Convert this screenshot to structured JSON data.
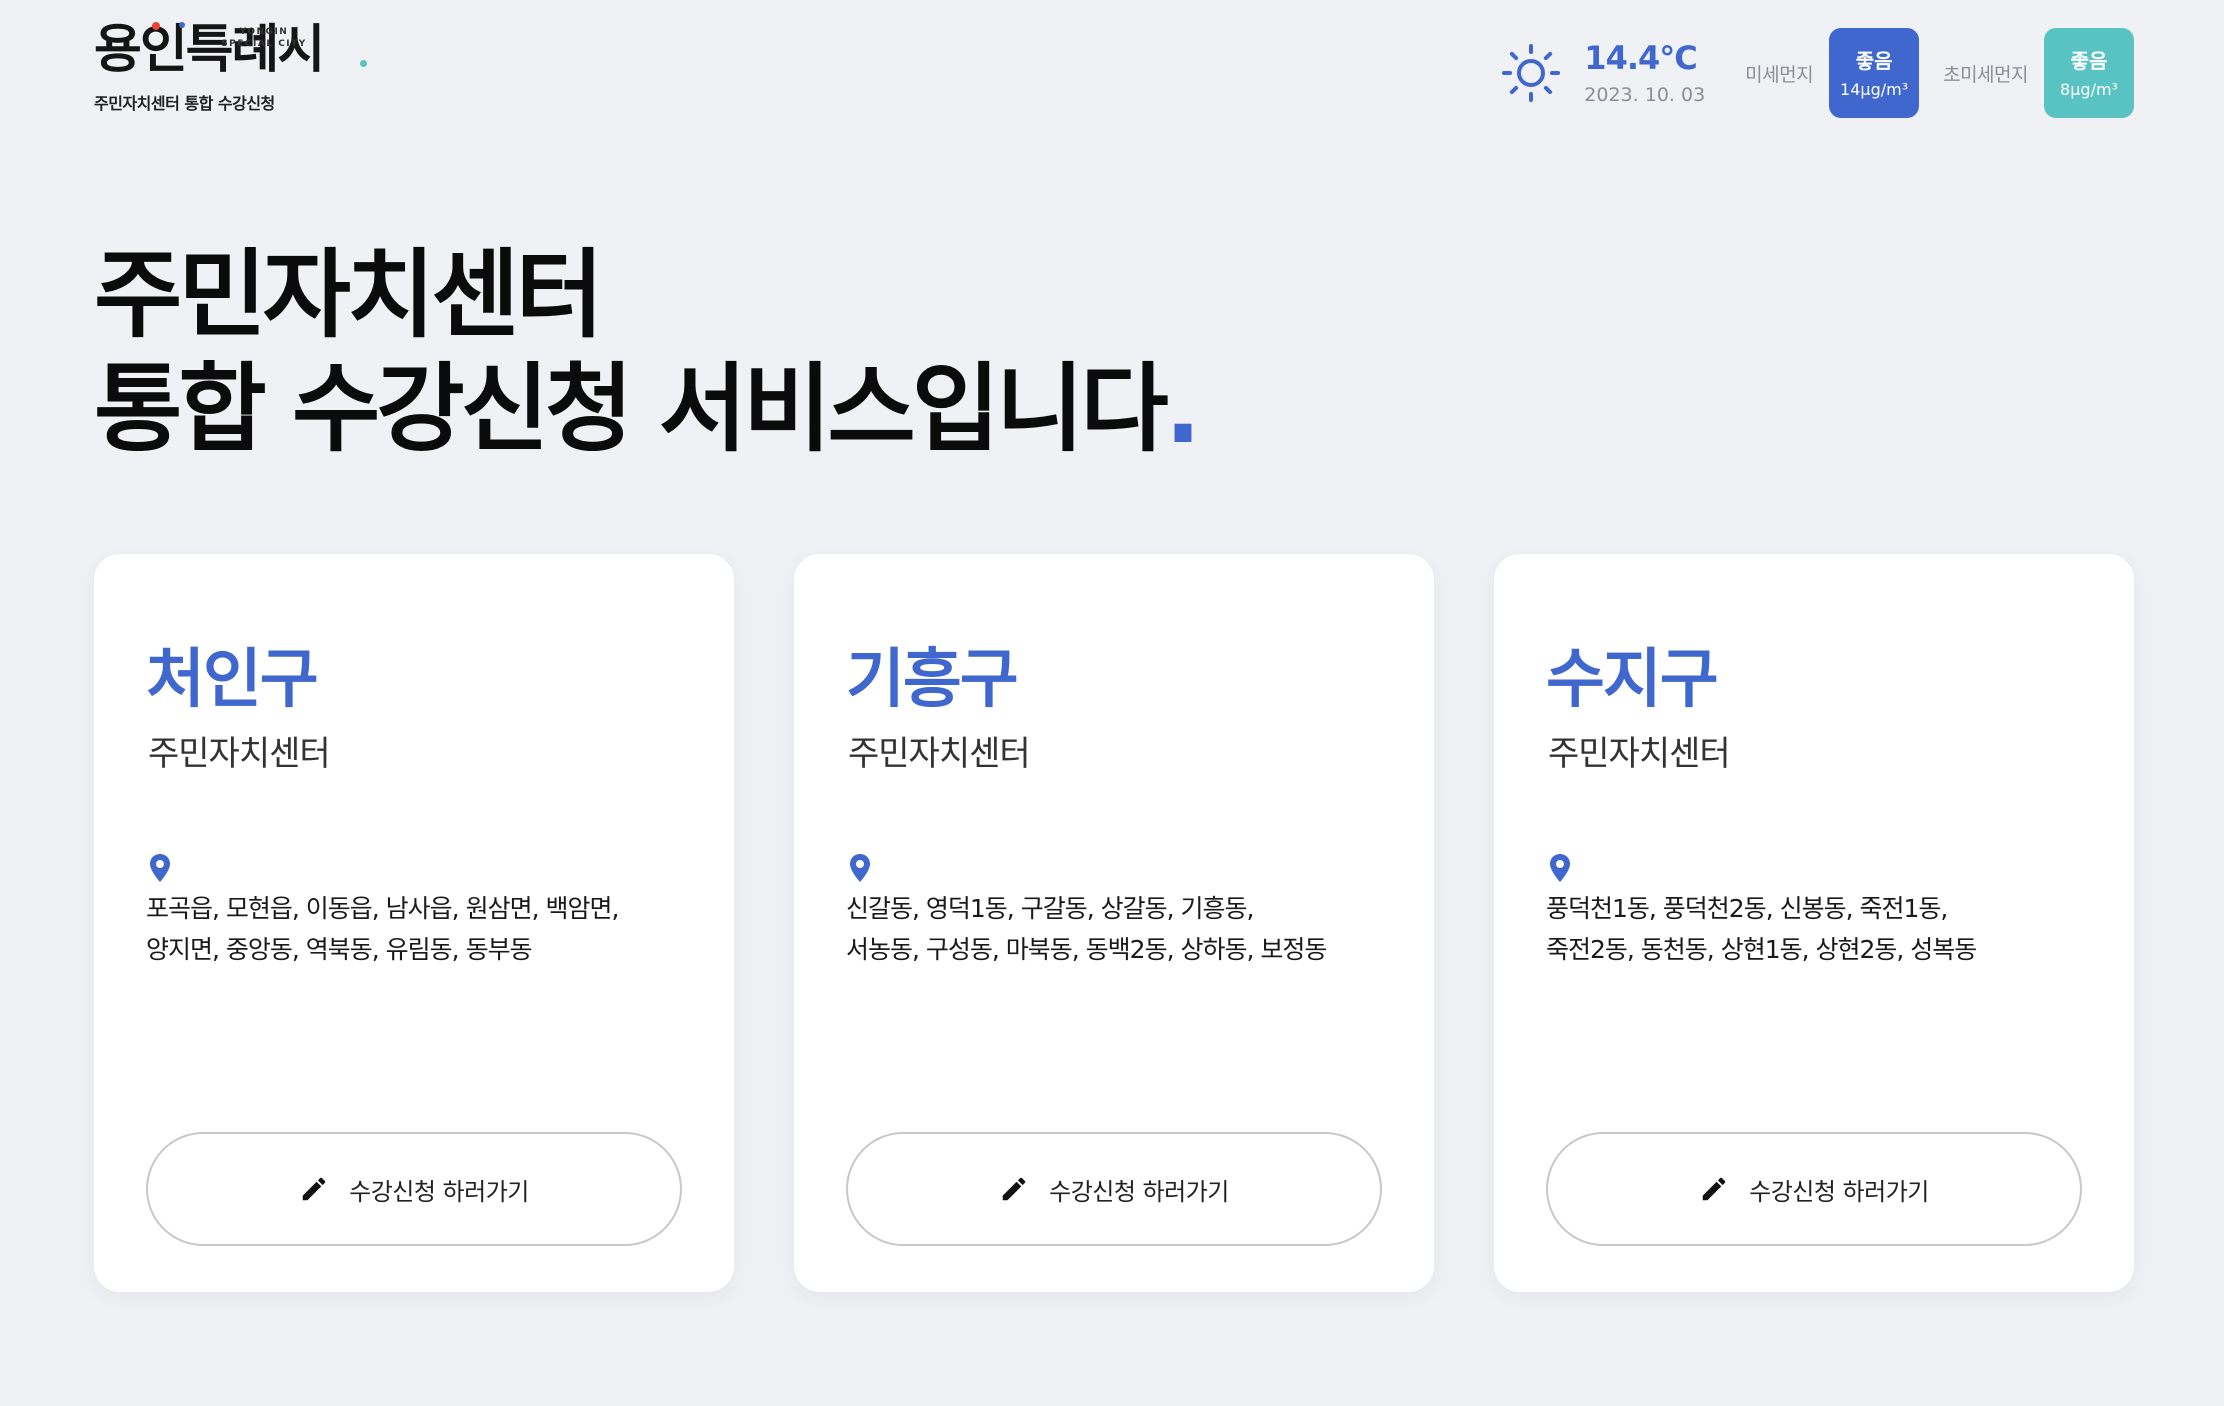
{
  "logo": {
    "word": "용인특례시",
    "en_line1": "YONGIN",
    "en_line2": "SPECIAL CITY",
    "subtitle": "주민자치센터 통합 수강신청",
    "dot_colors": [
      "#e8452f",
      "#3f67cd",
      "#59c3c3"
    ]
  },
  "weather": {
    "icon": "sun-icon",
    "temperature": "14.4°C",
    "date": "2023. 10. 03",
    "fine_dust": {
      "label": "미세먼지",
      "status": "좋음",
      "value": "14μg/m³",
      "color": "#3f67cd"
    },
    "ultra_fine_dust": {
      "label": "초미세먼지",
      "status": "좋음",
      "value": "8μg/m³",
      "color": "#59c3c3"
    }
  },
  "headline": {
    "line1": "주민자치센터",
    "line2": "통합 수강신청 서비스입니다",
    "dot": ".",
    "accent_color": "#3f67cd"
  },
  "cards": [
    {
      "title": "처인구",
      "subtitle": "주민자치센터",
      "areas_line1": "포곡읍, 모현읍, 이동읍, 남사읍, 원삼면, 백암면,",
      "areas_line2": "양지면, 중앙동, 역북동, 유림동, 동부동",
      "button": "수강신청 하러가기"
    },
    {
      "title": "기흥구",
      "subtitle": "주민자치센터",
      "areas_line1": "신갈동, 영덕1동, 구갈동, 상갈동, 기흥동,",
      "areas_line2": "서농동, 구성동, 마북동, 동백2동, 상하동, 보정동",
      "button": "수강신청 하러가기"
    },
    {
      "title": "수지구",
      "subtitle": "주민자치센터",
      "areas_line1": "풍덕천1동, 풍덕천2동, 신봉동, 죽전1동,",
      "areas_line2": "죽전2동, 동천동, 상현1동, 상현2동, 성복동",
      "button": "수강신청 하러가기"
    }
  ]
}
